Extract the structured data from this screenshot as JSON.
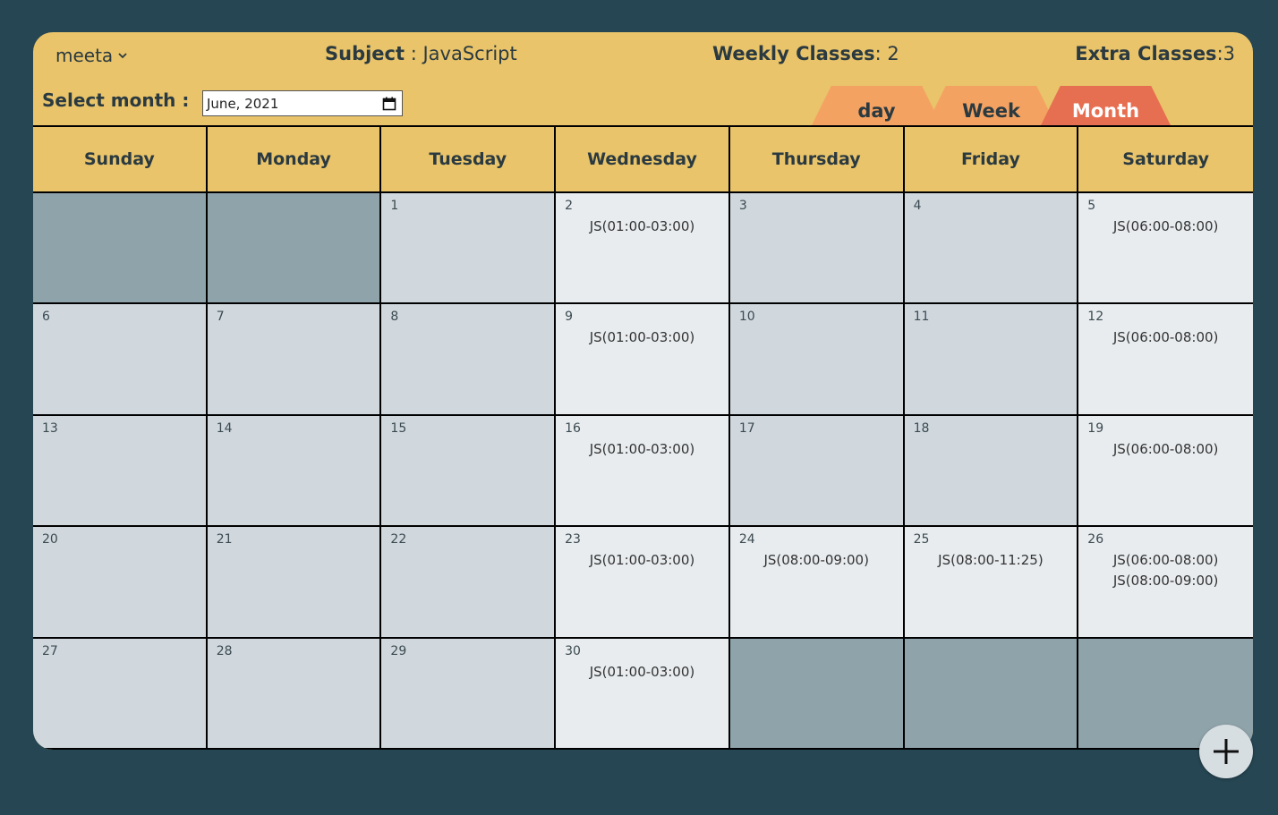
{
  "header": {
    "user": "meeta",
    "subject_label": "Subject",
    "subject_value": " : JavaScript",
    "weekly_label": "Weekly Classes",
    "weekly_value": ": 2",
    "extra_label": "Extra Classes",
    "extra_value": ":3"
  },
  "month_select": {
    "label": "Select month :",
    "value": "June, 2021"
  },
  "tabs": {
    "day": "day",
    "week": "Week",
    "month": "Month",
    "active": "Month"
  },
  "weekdays": [
    "Sunday",
    "Monday",
    "Tuesday",
    "Wednesday",
    "Thursday",
    "Friday",
    "Saturday"
  ],
  "days": [
    {
      "n": "",
      "ev": [],
      "out": true
    },
    {
      "n": "",
      "ev": [],
      "out": true
    },
    {
      "n": "1",
      "ev": []
    },
    {
      "n": "2",
      "ev": [
        "JS(01:00-03:00)"
      ]
    },
    {
      "n": "3",
      "ev": []
    },
    {
      "n": "4",
      "ev": []
    },
    {
      "n": "5",
      "ev": [
        "JS(06:00-08:00)"
      ]
    },
    {
      "n": "6",
      "ev": []
    },
    {
      "n": "7",
      "ev": []
    },
    {
      "n": "8",
      "ev": []
    },
    {
      "n": "9",
      "ev": [
        "JS(01:00-03:00)"
      ]
    },
    {
      "n": "10",
      "ev": []
    },
    {
      "n": "11",
      "ev": []
    },
    {
      "n": "12",
      "ev": [
        "JS(06:00-08:00)"
      ]
    },
    {
      "n": "13",
      "ev": []
    },
    {
      "n": "14",
      "ev": []
    },
    {
      "n": "15",
      "ev": []
    },
    {
      "n": "16",
      "ev": [
        "JS(01:00-03:00)"
      ]
    },
    {
      "n": "17",
      "ev": []
    },
    {
      "n": "18",
      "ev": []
    },
    {
      "n": "19",
      "ev": [
        "JS(06:00-08:00)"
      ]
    },
    {
      "n": "20",
      "ev": []
    },
    {
      "n": "21",
      "ev": []
    },
    {
      "n": "22",
      "ev": []
    },
    {
      "n": "23",
      "ev": [
        "JS(01:00-03:00)"
      ]
    },
    {
      "n": "24",
      "ev": [
        "JS(08:00-09:00)"
      ]
    },
    {
      "n": "25",
      "ev": [
        "JS(08:00-11:25)"
      ]
    },
    {
      "n": "26",
      "ev": [
        "JS(06:00-08:00)",
        "JS(08:00-09:00)"
      ]
    },
    {
      "n": "27",
      "ev": []
    },
    {
      "n": "28",
      "ev": []
    },
    {
      "n": "29",
      "ev": []
    },
    {
      "n": "30",
      "ev": [
        "JS(01:00-03:00)"
      ]
    },
    {
      "n": "",
      "ev": [],
      "out": true
    },
    {
      "n": "",
      "ev": [],
      "out": true
    },
    {
      "n": "",
      "ev": [],
      "out": true
    }
  ],
  "colors": {
    "background": "#264653",
    "card": "#e9c46a",
    "tab_inactive": "#f4a261",
    "tab_active": "#e76f51",
    "cell_empty": "#d0d8de",
    "cell_event": "#e8ecef",
    "cell_outside": "#8fa3aa"
  },
  "icons": {
    "user_menu": "chevron-down-icon",
    "date_picker": "calendar-icon",
    "add": "plus-icon"
  }
}
